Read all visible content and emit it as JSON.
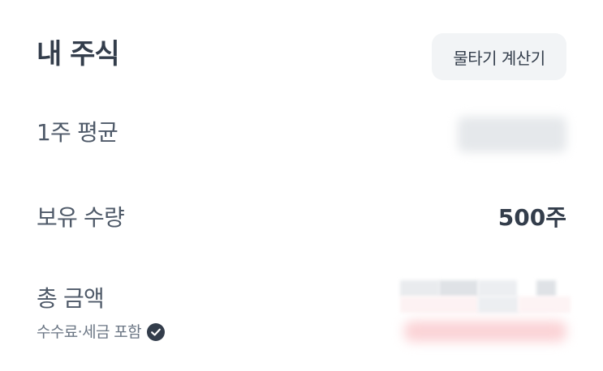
{
  "header": {
    "title": "내 주식",
    "calc_button_label": "물타기 계산기"
  },
  "rows": {
    "avg_price_label": "1주 평균",
    "quantity_label": "보유 수량",
    "quantity_value": "500주",
    "total_label": "총 금액",
    "fee_note": "수수료·세금 포함"
  },
  "icons": {
    "fee_info": "check-circle-icon"
  },
  "colors": {
    "title": "#333d4b",
    "label": "#4e5968",
    "sub_label": "#6b7684",
    "button_bg": "#f2f4f6",
    "icon_bg": "#333d4b"
  }
}
